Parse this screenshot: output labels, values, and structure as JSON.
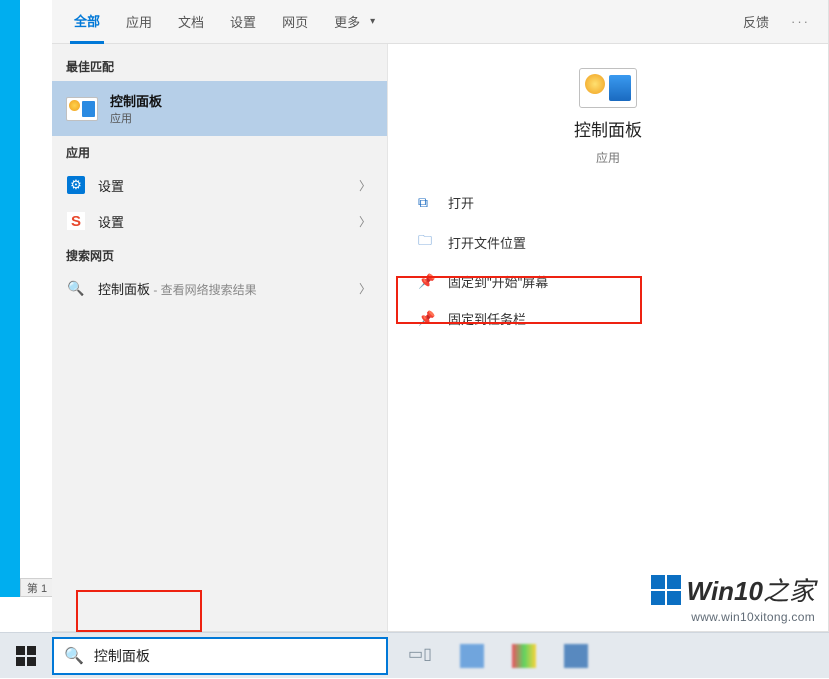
{
  "tabs": {
    "all": "全部",
    "apps": "应用",
    "docs": "文档",
    "settings": "设置",
    "web": "网页",
    "more": "更多",
    "feedback": "反馈"
  },
  "sections": {
    "best_match": "最佳匹配",
    "apps": "应用",
    "search_web": "搜索网页"
  },
  "best": {
    "title": "控制面板",
    "subtitle": "应用"
  },
  "apps_list": [
    {
      "label": "设置"
    },
    {
      "label": "设置"
    }
  ],
  "web": {
    "term": "控制面板",
    "suffix": " - 查看网络搜索结果"
  },
  "preview": {
    "title": "控制面板",
    "subtitle": "应用"
  },
  "actions": {
    "open": "打开",
    "open_location": "打开文件位置",
    "pin_start": "固定到\"开始\"屏幕",
    "pin_taskbar": "固定到任务栏"
  },
  "search": {
    "value": "控制面板"
  },
  "watermark": {
    "brand_a": "Win10",
    "brand_b": "之家",
    "url": "www.win10xitong.com"
  },
  "sheet_tab": "第 1"
}
